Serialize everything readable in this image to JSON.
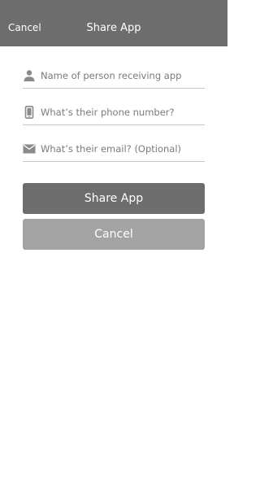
{
  "header": {
    "cancel_label": "Cancel",
    "title": "Share App"
  },
  "form": {
    "name_placeholder": "Name of person receiving app",
    "phone_placeholder": "What’s their phone number?",
    "email_placeholder": "What’s their email? (Optional)"
  },
  "buttons": {
    "share_label": "Share App",
    "cancel_label": "Cancel"
  },
  "icons": {
    "name": "person-icon",
    "phone": "phone-icon",
    "email": "mail-icon"
  },
  "colors": {
    "header_bg": "#6d6d6d",
    "primary_button": "#6d6d6d",
    "secondary_button": "#a3a3a3",
    "divider": "#c8c8c8"
  }
}
